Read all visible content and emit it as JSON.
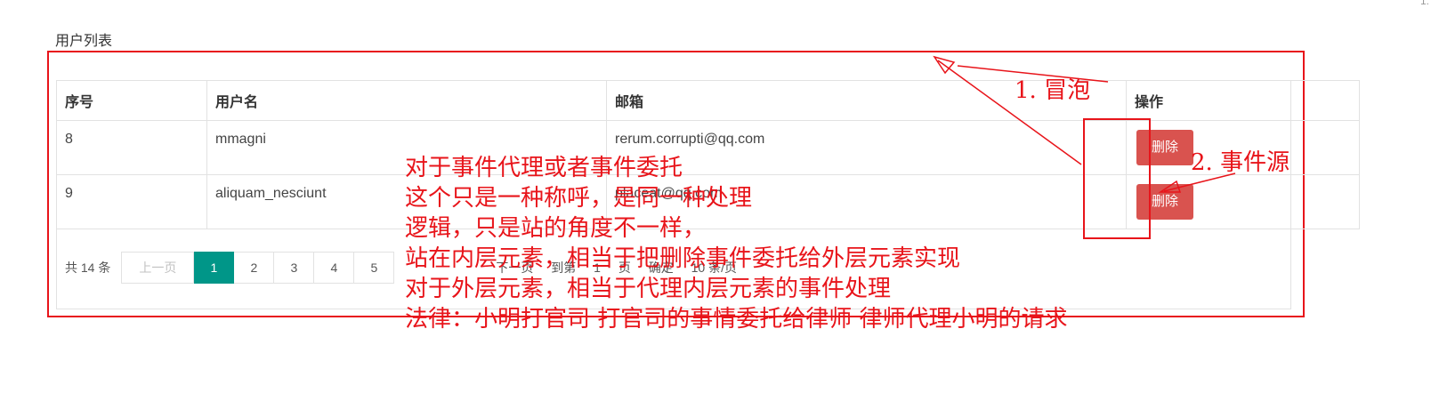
{
  "corner_text": "1:",
  "page_title": "用户列表",
  "table": {
    "headers": [
      "序号",
      "用户名",
      "邮箱",
      "操作"
    ],
    "rows": [
      {
        "id": "8",
        "username": "mmagni",
        "email": "rerum.corrupti@qq.com",
        "action": "删除"
      },
      {
        "id": "9",
        "username": "aliquam_nesciunt",
        "email": "placeat@qq.com",
        "action": "删除"
      }
    ]
  },
  "pager": {
    "total": "共 14 条",
    "prev": "上一页",
    "pages": [
      "1",
      "2",
      "3",
      "4",
      "5"
    ],
    "current": "1",
    "next": "下一页",
    "goto_prefix": "到第",
    "goto_value": "1",
    "goto_suffix": "页",
    "confirm": "确定",
    "per_page": "10 条/页"
  },
  "annotations": {
    "bubble": "1. 冒泡",
    "source": "2. 事件源",
    "lines": [
      "对于事件代理或者事件委托",
      "这个只是一种称呼，是同一种处理",
      "逻辑，只是站的角度不一样，",
      "站在内层元素，相当于把删除事件委托给外层元素实现",
      "对于外层元素，相当于代理内层元素的事件处理",
      "法律：小明打官司 打官司的事情委托给律师 律师代理小明的请求"
    ],
    "color": "#e8141a"
  },
  "colors": {
    "delete_button": "#d9534f",
    "active_page": "#009688"
  }
}
